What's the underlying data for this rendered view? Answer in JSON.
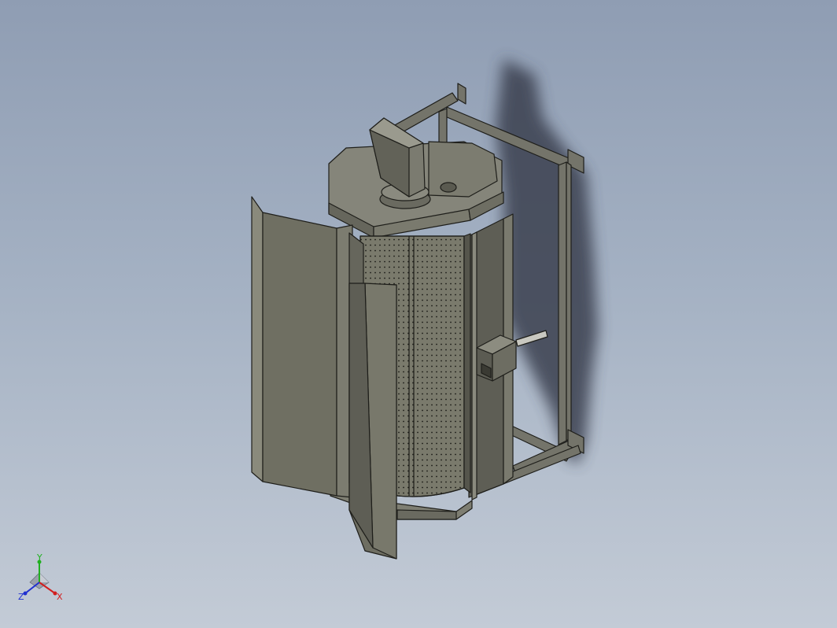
{
  "viewport": {
    "background_top": "#8f9db3",
    "background_bottom": "#c3cbd6"
  },
  "model": {
    "body_color": "#6f6f62",
    "edge_color": "#1e1e1a",
    "shadow_color": "#3a4150"
  },
  "triad": {
    "x_label": "X",
    "y_label": "Y",
    "z_label": "Z",
    "x_color": "#d21e1e",
    "y_color": "#20b020",
    "z_color": "#2030d0"
  }
}
